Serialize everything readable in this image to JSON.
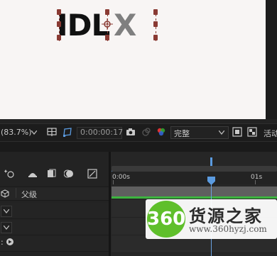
{
  "viewer": {
    "logo_text_dark": "IDL",
    "logo_text_light": "X"
  },
  "viewer_toolbar": {
    "zoom": "(83.7%)",
    "timecode": "0:00:00:17",
    "resolution": "完整",
    "active_camera": "活动"
  },
  "timeline": {
    "parent_column_label": "父级",
    "ruler_labels": [
      "0:00s",
      "01s"
    ]
  },
  "watermark": {
    "badge": "360",
    "site_name": "货源之家",
    "url": "www.360hyzj.com"
  },
  "colors": {
    "accent_blue": "#5b9be0",
    "comp_bar_green": "#3db53f",
    "handle_red": "#8a3a33",
    "viewer_bg": "#f8f5f4"
  }
}
